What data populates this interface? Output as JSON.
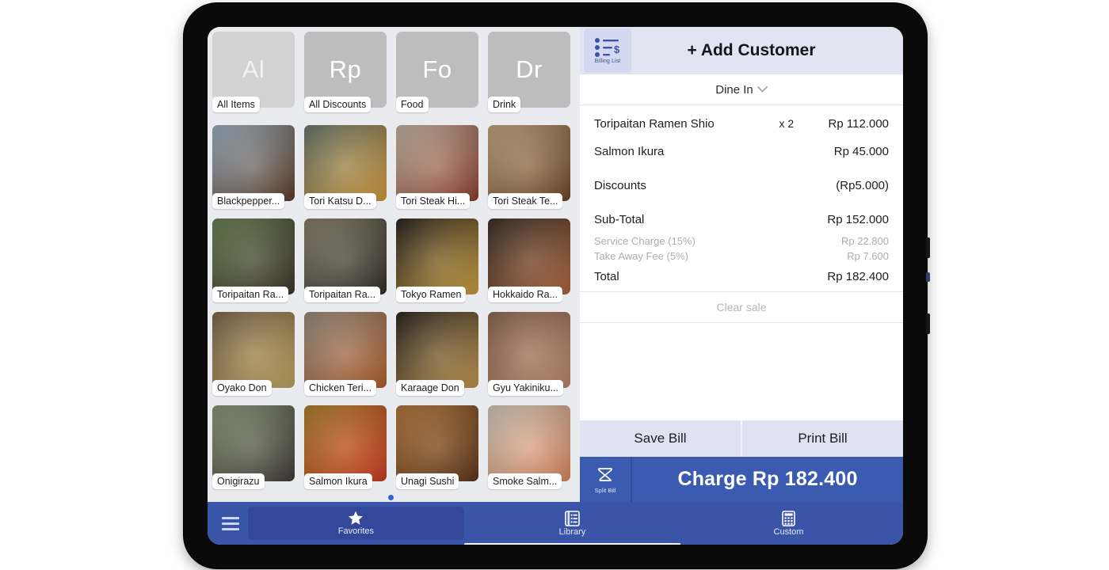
{
  "order": {
    "billing_list_label": "Billing List",
    "add_customer_label": "+ Add Customer",
    "order_type": "Dine In",
    "items": [
      {
        "name": "Toripaitan Ramen Shio",
        "qty": "x 2",
        "amount": "Rp 112.000"
      },
      {
        "name": "Salmon Ikura",
        "qty": "",
        "amount": "Rp 45.000"
      },
      {
        "name": "Discounts",
        "qty": "",
        "amount": "(Rp5.000)"
      }
    ],
    "subtotal_label": "Sub-Total",
    "subtotal_amount": "Rp 152.000",
    "fees": [
      {
        "label": "Service Charge (15%)",
        "amount": "Rp 22.800"
      },
      {
        "label": "Take Away Fee (5%)",
        "amount": "Rp 7.600"
      }
    ],
    "total_label": "Total",
    "total_amount": "Rp 182.400",
    "clear_sale_label": "Clear sale",
    "save_bill_label": "Save Bill",
    "print_bill_label": "Print Bill",
    "split_bill_label": "Split Bill",
    "charge_label": "Charge Rp 182.400"
  },
  "catalog": {
    "categories": [
      {
        "abbr": "Al",
        "label": "All Items",
        "selected": true
      },
      {
        "abbr": "Rp",
        "label": "All Discounts",
        "selected": false
      },
      {
        "abbr": "Fo",
        "label": "Food",
        "selected": false
      },
      {
        "abbr": "Dr",
        "label": "Drink",
        "selected": false
      }
    ],
    "products": [
      {
        "label": "Blackpepper...",
        "c1": "#9fb4c6",
        "c2": "#5b3a22"
      },
      {
        "label": "Tori Katsu D...",
        "c1": "#6b7a6e",
        "c2": "#d79b3a"
      },
      {
        "label": "Tori Steak Hi...",
        "c1": "#c8b9a6",
        "c2": "#8d3c2c"
      },
      {
        "label": "Tori Steak Te...",
        "c1": "#c4a882",
        "c2": "#6e4522"
      },
      {
        "label": "Toripaitan Ra...",
        "c1": "#6d8455",
        "c2": "#3a3026"
      },
      {
        "label": "Toripaitan Ra...",
        "c1": "#8b8270",
        "c2": "#2e2a22"
      },
      {
        "label": "Tokyo Ramen",
        "c1": "#2a2520",
        "c2": "#d2a33c"
      },
      {
        "label": "Hokkaido Ra...",
        "c1": "#38302a",
        "c2": "#b5683a"
      },
      {
        "label": "Oyako Don",
        "c1": "#7f6a4e",
        "c2": "#c2a85f"
      },
      {
        "label": "Chicken Teri...",
        "c1": "#9a8f82",
        "c2": "#b45f2a"
      },
      {
        "label": "Karaage Don",
        "c1": "#2c2722",
        "c2": "#c79a4e"
      },
      {
        "label": "Gyu Yakiniku...",
        "c1": "#8e6a55",
        "c2": "#c08b6e"
      },
      {
        "label": "Onigirazu",
        "c1": "#8f9a7c",
        "c2": "#3d3a33"
      },
      {
        "label": "Salmon Ikura",
        "c1": "#b1832f",
        "c2": "#cf3a1e"
      },
      {
        "label": "Unagi Sushi",
        "c1": "#b67b3c",
        "c2": "#5d3318"
      },
      {
        "label": "Smoke Salm...",
        "c1": "#d8cfc2",
        "c2": "#e0895e"
      }
    ]
  },
  "nav": {
    "tabs": [
      {
        "label": "Favorites",
        "icon": "star-icon",
        "active": true
      },
      {
        "label": "Library",
        "icon": "list-icon",
        "active": false
      },
      {
        "label": "Custom",
        "icon": "calculator-icon",
        "active": false
      }
    ]
  },
  "colors": {
    "brand_blue": "#3a55a8",
    "charge_blue": "#3a5bb0",
    "header_lavender": "#e2e5f1",
    "grid_bg": "#e9ebee"
  }
}
